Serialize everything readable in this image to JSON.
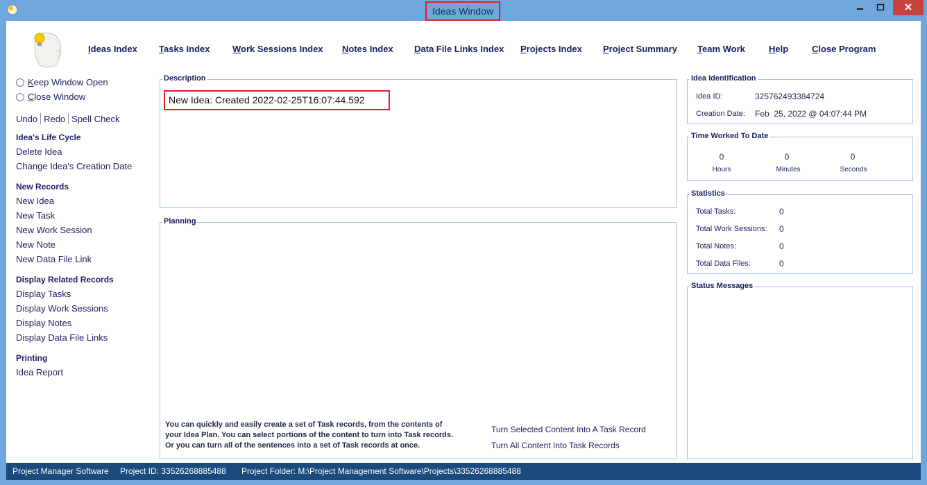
{
  "window": {
    "title": "Ideas Window",
    "colors": {
      "frame": "#6fa6db",
      "close": "#c9413b",
      "status_bar": "#1b4a7d",
      "highlight": "#e01f26"
    }
  },
  "nav": {
    "ideas_index": "Ideas Index",
    "tasks_index": "Tasks Index",
    "work_sessions_index": "Work Sessions Index",
    "notes_index": "Notes Index",
    "data_file_links_index": "Data File Links Index",
    "projects_index": "Projects Index",
    "project_summary": "Project Summary",
    "team_work": "Team Work",
    "help": "Help",
    "close_program": "Close Program"
  },
  "sidebar": {
    "keep_window_open": "Keep Window Open",
    "close_window": "Close Window",
    "undo": "Undo",
    "redo": "Redo",
    "spell_check": "Spell Check",
    "life_cycle": {
      "heading": "Idea's Life Cycle",
      "delete_idea": "Delete Idea",
      "change_creation_date": "Change Idea's Creation Date"
    },
    "new_records": {
      "heading": "New Records",
      "new_idea": "New Idea",
      "new_task": "New Task",
      "new_work_session": "New Work Session",
      "new_note": "New Note",
      "new_data_file_link": "New Data File Link"
    },
    "display_related": {
      "heading": "Display Related Records",
      "display_tasks": "Display Tasks",
      "display_work_sessions": "Display Work Sessions",
      "display_notes": "Display Notes",
      "display_data_file_links": "Display Data File Links"
    },
    "printing": {
      "heading": "Printing",
      "idea_report": "Idea Report"
    }
  },
  "description": {
    "label": "Description",
    "text": "New Idea: Created 2022-02-25T16:07:44.592"
  },
  "planning": {
    "label": "Planning",
    "help_line1": "You can quickly and easily create a set of Task records, from the contents of",
    "help_line2": "your Idea Plan. You can select portions of the content to turn into Task records.",
    "help_line3": "Or you can turn all of the sentences into a set of Task records at once.",
    "turn_selected": "Turn Selected Content Into A Task Record",
    "turn_all": "Turn All Content Into Task Records"
  },
  "identification": {
    "label": "Idea Identification",
    "idea_id_label": "Idea ID:",
    "idea_id": "325762493384724",
    "creation_date_label": "Creation Date:",
    "creation_date": "Feb  25, 2022 @ 04:07:44 PM"
  },
  "time_worked": {
    "label": "Time Worked To Date",
    "hours": "0",
    "hours_label": "Hours",
    "minutes": "0",
    "minutes_label": "Minutes",
    "seconds": "0",
    "seconds_label": "Seconds"
  },
  "statistics": {
    "label": "Statistics",
    "total_tasks_label": "Total Tasks:",
    "total_tasks": "0",
    "total_work_sessions_label": "Total Work Sessions:",
    "total_work_sessions": "0",
    "total_notes_label": "Total Notes:",
    "total_notes": "0",
    "total_data_files_label": "Total Data Files:",
    "total_data_files": "0"
  },
  "status_messages": {
    "label": "Status Messages"
  },
  "status_bar": {
    "app_name": "Project Manager Software",
    "project_id": "Project ID:  33526268885488",
    "project_folder": "Project Folder: M:\\Project Management Software\\Projects\\33526268885488"
  }
}
